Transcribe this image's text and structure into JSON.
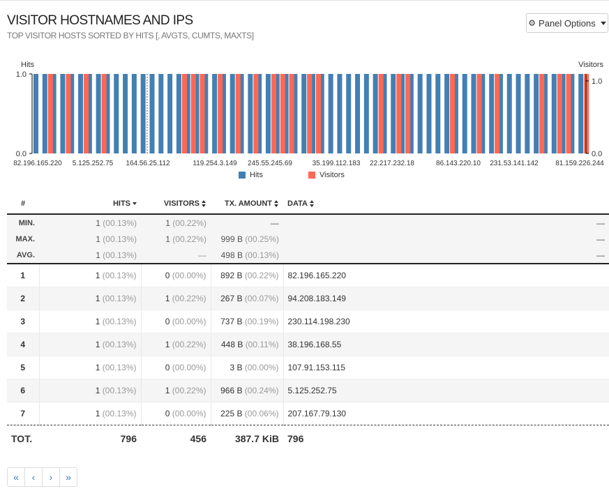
{
  "panel": {
    "title": "VISITOR HOSTNAMES AND IPS",
    "subtitle": "TOP VISITOR HOSTS SORTED BY HITS [, AVGTS, CUMTS, MAXTS]",
    "options_label": "Panel Options",
    "options_icon": "gear-icon"
  },
  "chart_data": {
    "type": "bar",
    "y_left_label": "Hits",
    "y_right_label": "Visitors",
    "y_left_ticks": [
      "0.0",
      "1.0"
    ],
    "y_right_ticks": [
      "0.0",
      "1.0"
    ],
    "ylim": [
      0,
      1
    ],
    "x_tick_labels": [
      "82.196.165.220",
      "5.125.252.75",
      "164.56.25.112",
      "119.254.3.149",
      "245.55.245.69",
      "35.199.112.183",
      "22.217.232.18",
      "86.143.220.10",
      "231.53.141.142",
      "81.159.226.244"
    ],
    "series": [
      {
        "name": "Hits",
        "color": "#447fb3",
        "values": [
          1,
          1,
          1,
          1,
          1,
          1,
          1,
          1,
          1,
          1,
          1,
          1,
          1,
          1,
          1,
          1,
          1,
          1,
          1,
          1,
          1,
          1,
          1,
          1,
          1,
          1,
          1,
          1,
          1,
          1,
          1,
          1,
          1,
          1,
          1,
          1,
          1,
          1,
          1,
          1,
          1,
          1,
          1,
          1,
          1,
          1,
          1,
          1,
          1,
          1,
          1,
          1,
          1,
          1,
          1,
          1,
          1,
          1,
          1,
          1,
          1,
          1
        ]
      },
      {
        "name": "Visitors",
        "color": "#ff6854",
        "values": [
          0,
          1,
          0,
          1,
          0,
          1,
          0,
          1,
          0,
          0,
          0,
          0,
          0,
          0,
          0,
          0,
          1,
          1,
          1,
          0,
          1,
          0,
          1,
          0,
          1,
          0,
          1,
          1,
          1,
          0,
          1,
          1,
          0,
          0,
          0,
          0,
          0,
          0,
          1,
          0,
          1,
          1,
          0,
          0,
          0,
          0,
          1,
          0,
          0,
          1,
          0,
          1,
          0,
          0,
          0,
          0,
          1,
          0,
          1,
          1,
          0,
          1
        ]
      }
    ],
    "legend": [
      "Hits",
      "Visitors"
    ]
  },
  "table": {
    "headers": {
      "num": "#",
      "hits": "HITS",
      "visitors": "VISITORS",
      "tx": "TX. AMOUNT",
      "data": "DATA"
    },
    "stats": [
      {
        "label": "MIN.",
        "hits": "1",
        "hits_pct": "(00.13%)",
        "visitors": "1",
        "visitors_pct": "(00.22%)",
        "tx": "—",
        "tx_pct": "",
        "data": "—"
      },
      {
        "label": "MAX.",
        "hits": "1",
        "hits_pct": "(00.13%)",
        "visitors": "1",
        "visitors_pct": "(00.22%)",
        "tx": "999 B",
        "tx_pct": "(00.25%)",
        "data": "—"
      },
      {
        "label": "AVG.",
        "hits": "1",
        "hits_pct": "(00.13%)",
        "visitors": "",
        "visitors_pct": "—",
        "tx": "498 B",
        "tx_pct": "(00.13%)",
        "data": "—"
      }
    ],
    "rows": [
      {
        "num": "1",
        "hits": "1",
        "hits_pct": "(00.13%)",
        "visitors": "0",
        "visitors_pct": "(00.00%)",
        "tx": "892 B",
        "tx_pct": "(00.22%)",
        "data": "82.196.165.220"
      },
      {
        "num": "2",
        "hits": "1",
        "hits_pct": "(00.13%)",
        "visitors": "1",
        "visitors_pct": "(00.22%)",
        "tx": "267 B",
        "tx_pct": "(00.07%)",
        "data": "94.208.183.149"
      },
      {
        "num": "3",
        "hits": "1",
        "hits_pct": "(00.13%)",
        "visitors": "0",
        "visitors_pct": "(00.00%)",
        "tx": "737 B",
        "tx_pct": "(00.19%)",
        "data": "230.114.198.230"
      },
      {
        "num": "4",
        "hits": "1",
        "hits_pct": "(00.13%)",
        "visitors": "1",
        "visitors_pct": "(00.22%)",
        "tx": "448 B",
        "tx_pct": "(00.11%)",
        "data": "38.196.168.55"
      },
      {
        "num": "5",
        "hits": "1",
        "hits_pct": "(00.13%)",
        "visitors": "0",
        "visitors_pct": "(00.00%)",
        "tx": "3 B",
        "tx_pct": "(00.00%)",
        "data": "107.91.153.115"
      },
      {
        "num": "6",
        "hits": "1",
        "hits_pct": "(00.13%)",
        "visitors": "1",
        "visitors_pct": "(00.22%)",
        "tx": "966 B",
        "tx_pct": "(00.24%)",
        "data": "5.125.252.75"
      },
      {
        "num": "7",
        "hits": "1",
        "hits_pct": "(00.13%)",
        "visitors": "0",
        "visitors_pct": "(00.00%)",
        "tx": "225 B",
        "tx_pct": "(00.06%)",
        "data": "207.167.79.130"
      }
    ],
    "totals": {
      "label": "TOT.",
      "hits": "796",
      "visitors": "456",
      "tx": "387.7 KiB",
      "data": "796"
    }
  },
  "pagination": {
    "first": "«",
    "prev": "‹",
    "next": "›",
    "last": "»"
  }
}
